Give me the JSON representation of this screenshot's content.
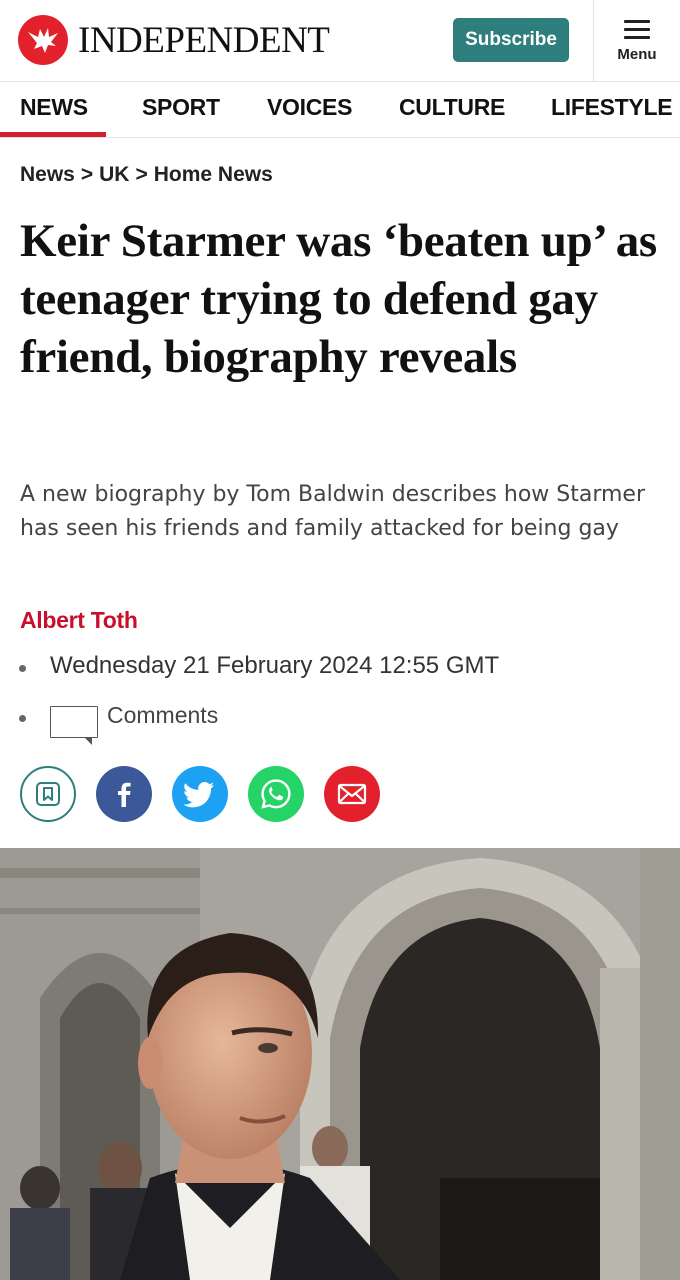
{
  "header": {
    "logo_text": "INDEPENDENT",
    "subscribe_label": "Subscribe",
    "menu_label": "Menu",
    "brand_color": "#e3212c",
    "subscribe_color": "#2e7e7e"
  },
  "nav": {
    "items": [
      "NEWS",
      "SPORT",
      "VOICES",
      "CULTURE",
      "LIFESTYLE"
    ],
    "active": "NEWS",
    "active_color": "#d0202f"
  },
  "breadcrumb": [
    "News",
    "UK",
    "Home News"
  ],
  "article": {
    "headline": "Keir Starmer was ‘beaten up’ as teenager trying to defend gay friend, biography reveals",
    "standfirst": "A new biography by Tom Baldwin describes how Starmer has seen his friends and family attacked for being gay",
    "author": "Albert Toth",
    "date": "Wednesday 21 February 2024 12:55 GMT",
    "comments_label": "Comments"
  },
  "share_icons": [
    {
      "name": "bookmark-icon",
      "color": "#2e7e7e"
    },
    {
      "name": "facebook-icon",
      "color": "#3b5998"
    },
    {
      "name": "twitter-icon",
      "color": "#1da1f2"
    },
    {
      "name": "whatsapp-icon",
      "color": "#25d366"
    },
    {
      "name": "email-icon",
      "color": "#e3212c"
    }
  ]
}
